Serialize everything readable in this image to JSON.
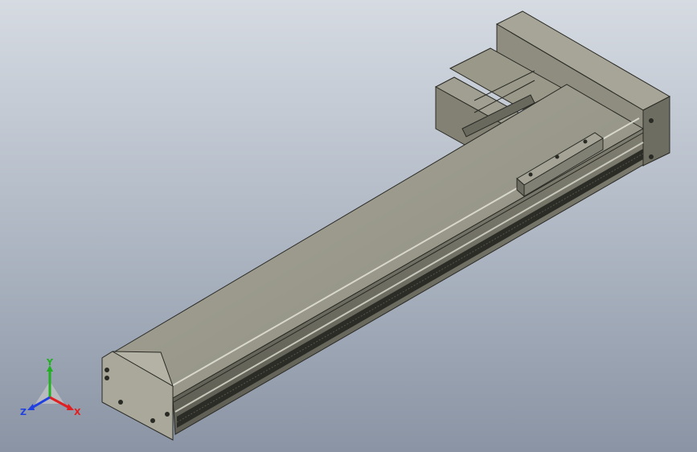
{
  "viewport": {
    "name": "cad-3d-viewport",
    "background_top": "#d6dbe2",
    "background_bottom": "#8a94a4"
  },
  "model": {
    "description_icon": "linear-actuator-model",
    "body_color": "#8d8c7e",
    "top_color": "#9e9d8f",
    "dark_color": "#3a3a34"
  },
  "triad": {
    "x_label": "X",
    "y_label": "Y",
    "z_label": "Z",
    "x_color": "#e02020",
    "y_color": "#20b020",
    "z_color": "#2040e0"
  }
}
